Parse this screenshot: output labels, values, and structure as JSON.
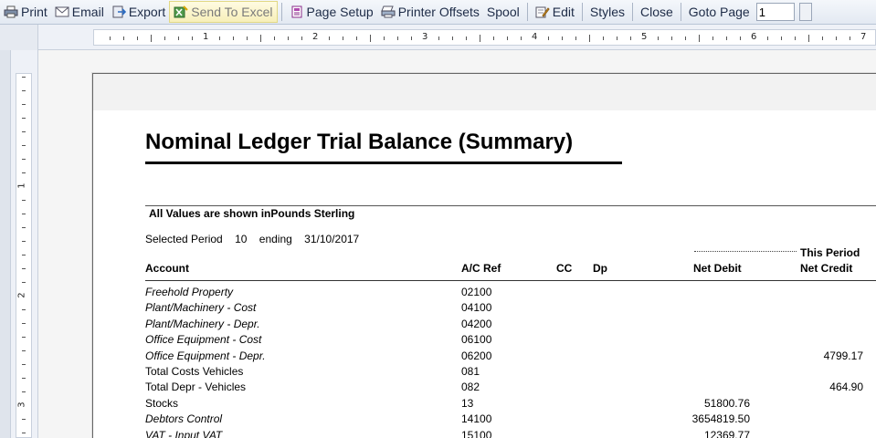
{
  "toolbar": {
    "print": "Print",
    "email": "Email",
    "export": "Export",
    "send_to_excel": "Send To Excel",
    "page_setup": "Page Setup",
    "printer_offsets": "Printer Offsets",
    "spool": "Spool",
    "edit": "Edit",
    "styles": "Styles",
    "close": "Close",
    "goto_page_label": "Goto Page",
    "goto_page_value": "1"
  },
  "ruler": {
    "top_numbers": [
      "1",
      "2",
      "3",
      "4",
      "5",
      "6",
      "7"
    ],
    "left_numbers": [
      "1",
      "2",
      "3"
    ]
  },
  "report": {
    "title": "Nominal Ledger Trial Balance (Summary)",
    "note": "All Values are shown inPounds Sterling",
    "selected_period_label": "Selected Period",
    "selected_period_value": "10",
    "ending_label": "ending",
    "ending_date": "31/10/2017",
    "this_period_label": "This Period",
    "columns": {
      "account": "Account",
      "ac_ref": "A/C Ref",
      "cc": "CC",
      "dp": "Dp",
      "net_debit": "Net Debit",
      "net_credit": "Net Credit"
    },
    "rows": [
      {
        "account": "Freehold Property",
        "ref": "02100",
        "debit": "",
        "credit": "",
        "italic": true
      },
      {
        "account": "Plant/Machinery - Cost",
        "ref": "04100",
        "debit": "",
        "credit": "",
        "italic": true
      },
      {
        "account": "Plant/Machinery - Depr.",
        "ref": "04200",
        "debit": "",
        "credit": "",
        "italic": true
      },
      {
        "account": "Office Equipment - Cost",
        "ref": "06100",
        "debit": "",
        "credit": "",
        "italic": true
      },
      {
        "account": "Office Equipment - Depr.",
        "ref": "06200",
        "debit": "",
        "credit": "4799.17",
        "italic": true
      },
      {
        "account": "Total Costs Vehicles",
        "ref": "081",
        "debit": "",
        "credit": "",
        "italic": false
      },
      {
        "account": "Total Depr - Vehicles",
        "ref": "082",
        "debit": "",
        "credit": "464.90",
        "italic": false
      },
      {
        "account": "Stocks",
        "ref": "13",
        "debit": "51800.76",
        "credit": "",
        "italic": false
      },
      {
        "account": "Debtors Control",
        "ref": "14100",
        "debit": "3654819.50",
        "credit": "",
        "italic": true
      },
      {
        "account": "VAT - Input VAT",
        "ref": "15100",
        "debit": "12369.77",
        "credit": "",
        "italic": true
      }
    ]
  }
}
